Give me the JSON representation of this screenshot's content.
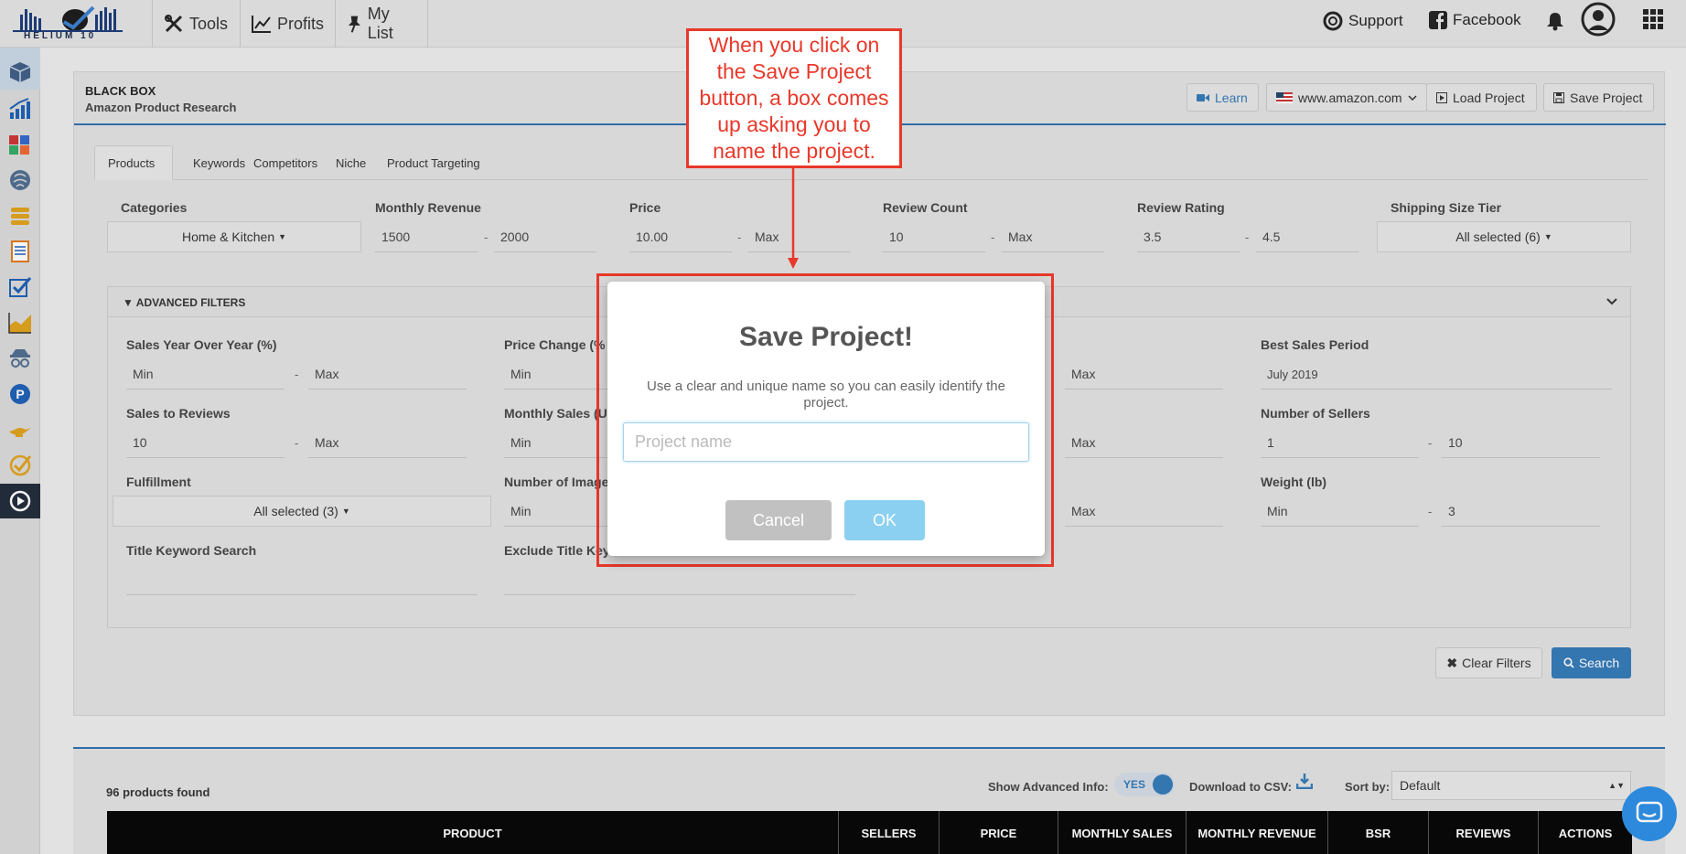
{
  "brand": {
    "logo_text": "HELIUM 10"
  },
  "topnav": {
    "tools": "Tools",
    "profits": "Profits",
    "my_list": "My List",
    "support": "Support",
    "facebook": "Facebook"
  },
  "header": {
    "title": "BLACK BOX",
    "subtitle": "Amazon Product Research",
    "learn": "Learn",
    "marketplace": "www.amazon.com",
    "load_project": "Load Project",
    "save_project": "Save Project"
  },
  "tabs": [
    "Products",
    "Keywords",
    "Competitors",
    "Niche",
    "Product Targeting"
  ],
  "filters": {
    "categories": {
      "label": "Categories",
      "value": "Home & Kitchen"
    },
    "monthly_revenue": {
      "label": "Monthly Revenue",
      "min": "1500",
      "max": "2000"
    },
    "price": {
      "label": "Price",
      "min": "10.00",
      "max": "Max"
    },
    "review_count": {
      "label": "Review Count",
      "min": "10",
      "max": "Max"
    },
    "review_rating": {
      "label": "Review Rating",
      "min": "3.5",
      "max": "4.5"
    },
    "shipping_size_tier": {
      "label": "Shipping Size Tier",
      "value": "All selected (6)"
    },
    "dash": "-"
  },
  "advanced": {
    "title": "ADVANCED FILTERS",
    "sales_yoy": {
      "label": "Sales Year Over Year (%)",
      "min": "Min",
      "max": "Max"
    },
    "price_change": {
      "label": "Price Change (%",
      "min": "Min"
    },
    "sales_to_reviews": {
      "label": "Sales to Reviews",
      "min": "10",
      "max": "Max"
    },
    "monthly_sales": {
      "label": "Monthly Sales (U",
      "min": "Min"
    },
    "fulfillment": {
      "label": "Fulfillment",
      "value": "All selected (3)"
    },
    "number_of_images": {
      "label": "Number of Image",
      "min": "Min"
    },
    "title_keyword": {
      "label": "Title Keyword Search"
    },
    "exclude_title": {
      "label": "Exclude Title Key"
    },
    "col3_max_1": "Max",
    "col3_max_2": "Max",
    "col3_max_3": "Max",
    "best_sales_period": {
      "label": "Best Sales Period",
      "value": "July 2019"
    },
    "number_of_sellers": {
      "label": "Number of Sellers",
      "min": "1",
      "max": "10"
    },
    "weight": {
      "label": "Weight (lb)",
      "min": "Min",
      "max": "3"
    }
  },
  "actions": {
    "clear_filters": "Clear Filters",
    "search": "Search"
  },
  "results": {
    "found": "96 products found",
    "show_advanced": "Show Advanced Info:",
    "toggle": "YES",
    "download_csv": "Download to CSV:",
    "sort_by": "Sort by:",
    "sort_value": "Default",
    "columns": [
      "PRODUCT",
      "SELLERS",
      "PRICE",
      "MONTHLY SALES",
      "MONTHLY REVENUE",
      "BSR",
      "REVIEWS",
      "ACTIONS"
    ]
  },
  "callout": {
    "text": "When you click on the Save Project button, a box comes up asking you to name the project."
  },
  "modal": {
    "title": "Save Project!",
    "text": "Use a clear and unique name so you can easily identify the project.",
    "placeholder": "Project name",
    "cancel": "Cancel",
    "ok": "OK"
  },
  "colors": {
    "accent": "#337ab7",
    "annotation": "#e8382a",
    "ok_button": "#8cd0f1",
    "cancel_button": "#c1c1c1"
  }
}
